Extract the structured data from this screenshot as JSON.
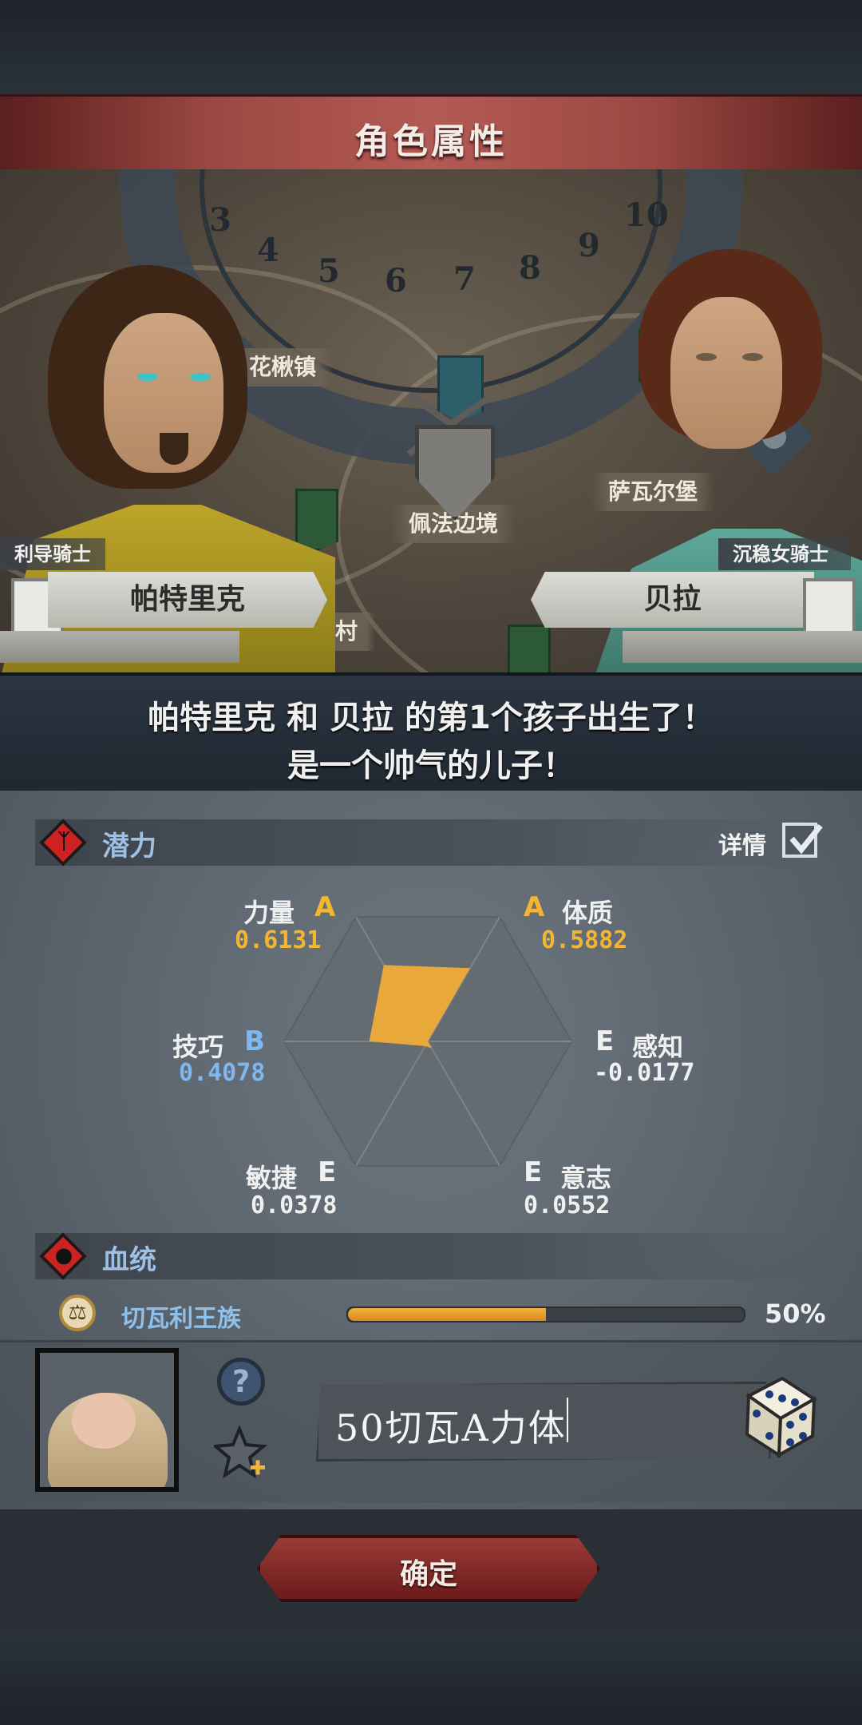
{
  "header": {
    "title": "角色属性"
  },
  "map": {
    "locations": [
      "花楸镇",
      "佩法边境",
      "萨瓦尔堡",
      "村"
    ],
    "wheel_numbers": [
      "3",
      "4",
      "5",
      "6",
      "7",
      "8",
      "9",
      "10"
    ]
  },
  "parents": {
    "father": {
      "title": "利导骑士",
      "name": "帕特里克"
    },
    "mother": {
      "title": "沉稳女骑士",
      "name": "贝拉"
    }
  },
  "message": {
    "line1": "帕特里克 和 贝拉 的第1个孩子出生了！",
    "line2": "是一个帅气的儿子！"
  },
  "potential": {
    "label": "潜力",
    "detail_label": "详情",
    "detail_checked": true,
    "stats": [
      {
        "name": "力量",
        "grade": "A",
        "value": "0.6131",
        "level": 0.6131
      },
      {
        "name": "体质",
        "grade": "A",
        "value": "0.5882",
        "level": 0.5882
      },
      {
        "name": "感知",
        "grade": "E",
        "value": "-0.0177",
        "level": 0.0
      },
      {
        "name": "意志",
        "grade": "E",
        "value": "0.0552",
        "level": 0.0552
      },
      {
        "name": "敏捷",
        "grade": "E",
        "value": "0.0378",
        "level": 0.0378
      },
      {
        "name": "技巧",
        "grade": "B",
        "value": "0.4078",
        "level": 0.4078
      }
    ]
  },
  "bloodline": {
    "label": "血统",
    "name": "切瓦利王族",
    "percent_text": "50%",
    "percent": 0.5
  },
  "child": {
    "name_input_value": "50切瓦A力体"
  },
  "confirm": {
    "label": "确定"
  },
  "colors": {
    "grade_a": "#f2b632",
    "grade_b": "#7fb8ee",
    "grade_e": "#f0f0f0",
    "radar_fill": "#e8a93a",
    "accent_red": "#cc2222"
  }
}
